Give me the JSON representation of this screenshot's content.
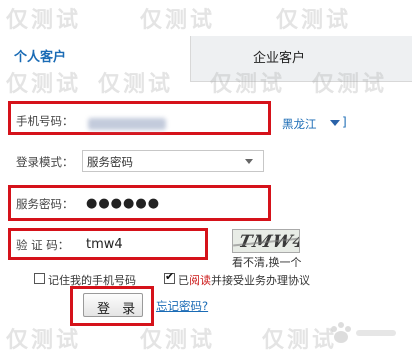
{
  "tabs": {
    "personal": "个人客户",
    "enterprise": "企业客户"
  },
  "form": {
    "phone_label": "手机号码：",
    "region_label": "黑龙江",
    "region_bracket": "]",
    "login_mode_label": "登录模式：",
    "login_mode_value": "服务密码",
    "password_label": "服务密码：",
    "password_dots": "●●●●●●",
    "captcha_label": "验 证 码：",
    "captcha_value": "tmw4",
    "captcha_image_text": "TMW4",
    "captcha_refresh": "看不清,换一个",
    "remember_label": "记住我的手机号码",
    "agree_prefix": "已",
    "agree_accent": "阅读",
    "agree_suffix": "并接受业务办理协议",
    "login_button": "登 录",
    "forgot_link": "忘记密码?"
  },
  "watermark": {
    "text": "仅测试"
  },
  "colors": {
    "link_blue": "#1a6bb5",
    "highlight_red": "#d5121a",
    "tab_inactive_bg": "#eef0f2"
  },
  "icons": {
    "region_dropdown": "triangle-down-icon",
    "select_dropdown": "chevron-down-icon"
  }
}
